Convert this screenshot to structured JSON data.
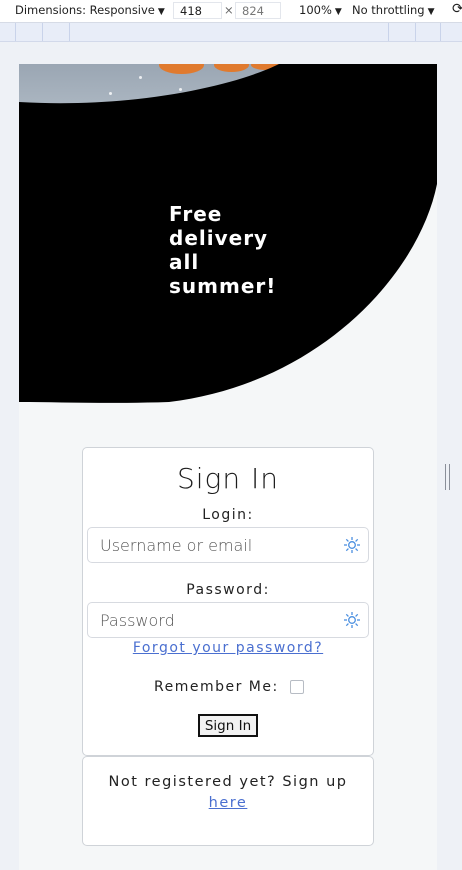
{
  "devtools": {
    "dimensions_label": "Dimensions: Responsive",
    "width_value": "418",
    "times": "×",
    "height_value": "824",
    "zoom": "100%",
    "throttling": "No throttling"
  },
  "hero": {
    "promo_text": "Free delivery all summer!"
  },
  "signin": {
    "title": "Sign In",
    "login_label": "Login:",
    "username_placeholder": "Username or email",
    "password_label": "Password:",
    "password_placeholder": "Password",
    "forgot_link": "Forgot your password?",
    "remember_label": "Remember Me:",
    "remember_checked": false,
    "submit_label": "Sign In"
  },
  "register": {
    "text": "Not registered yet? Sign up",
    "link": "here"
  },
  "colors": {
    "link": "#4a6fd0",
    "hero_black": "#000000",
    "page_bg": "#f5f7f8"
  }
}
